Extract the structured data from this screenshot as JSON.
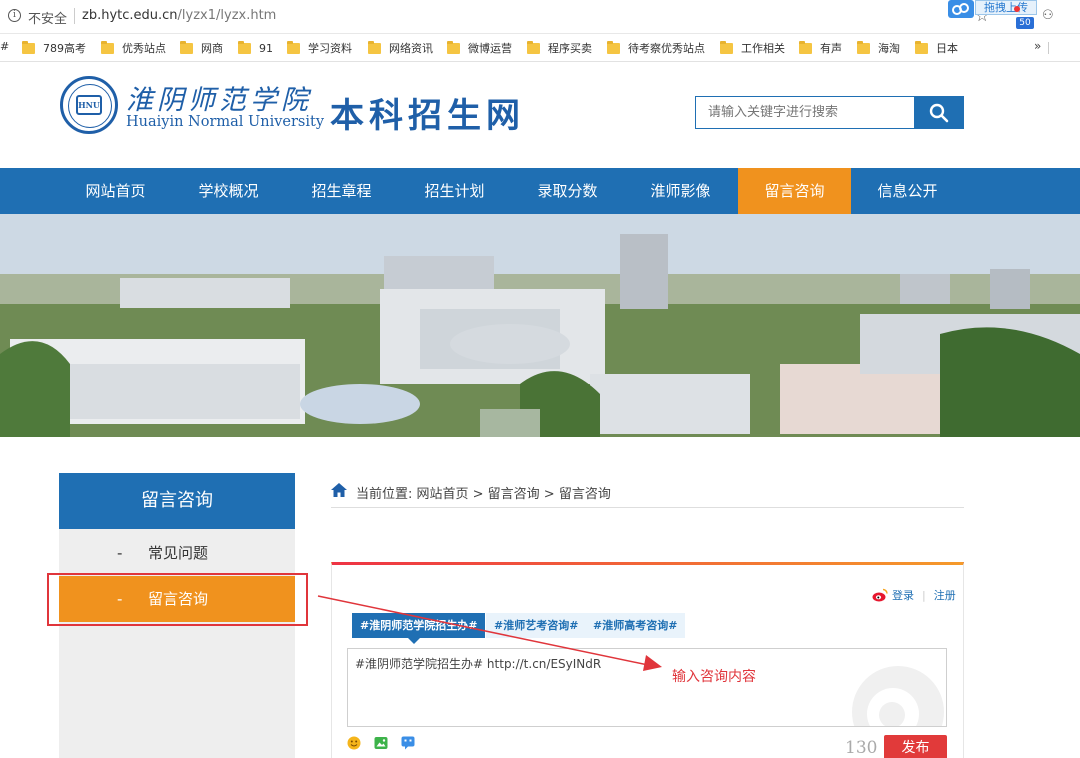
{
  "browser": {
    "insecure_label": "不安全",
    "url": "zb.hytc.edu.cn",
    "url_path": "/lyzx1/lyzx.htm",
    "upload_ext_label": "拖拽上传",
    "ext_badge": "50"
  },
  "bookmarks": {
    "hash": "#",
    "items": [
      "789高考",
      "优秀站点",
      "网商",
      "91",
      "学习资料",
      "网络资讯",
      "微博运营",
      "程序买卖",
      "待考察优秀站点",
      "工作相关",
      "有声",
      "海淘",
      "日本"
    ],
    "more": "»"
  },
  "header": {
    "seal_text": "HNU",
    "logo_cn": "淮阴师范学院",
    "logo_en": "Huaiyin Normal University",
    "site_title": "本科招生网",
    "search_placeholder": "请输入关键字进行搜索"
  },
  "nav": {
    "items": [
      "网站首页",
      "学校概况",
      "招生章程",
      "招生计划",
      "录取分数",
      "淮师影像",
      "留言咨询",
      "信息公开"
    ],
    "active_index": 6
  },
  "sidebar": {
    "title": "留言咨询",
    "items": [
      {
        "dash": "-",
        "label": "常见问题"
      },
      {
        "dash": "-",
        "label": "留言咨询"
      }
    ]
  },
  "breadcrumb": {
    "text": "当前位置: 网站首页 > 留言咨询 > 留言咨询"
  },
  "widget": {
    "login": "登录",
    "register": "注册",
    "tags": [
      "#淮阴师范学院招生办#",
      "#淮师艺考咨询#",
      "#淮师高考咨询#"
    ],
    "textarea_value": "#淮阴师范学院招生办# http://t.cn/ESyINdR",
    "char_count": "130",
    "publish": "发布"
  },
  "annotation": {
    "text": "输入咨询内容"
  },
  "colors": {
    "primary_blue": "#1f6fb3",
    "active_orange": "#f0921e",
    "annotation_red": "#e0353b",
    "publish_red": "#e13a3a"
  }
}
